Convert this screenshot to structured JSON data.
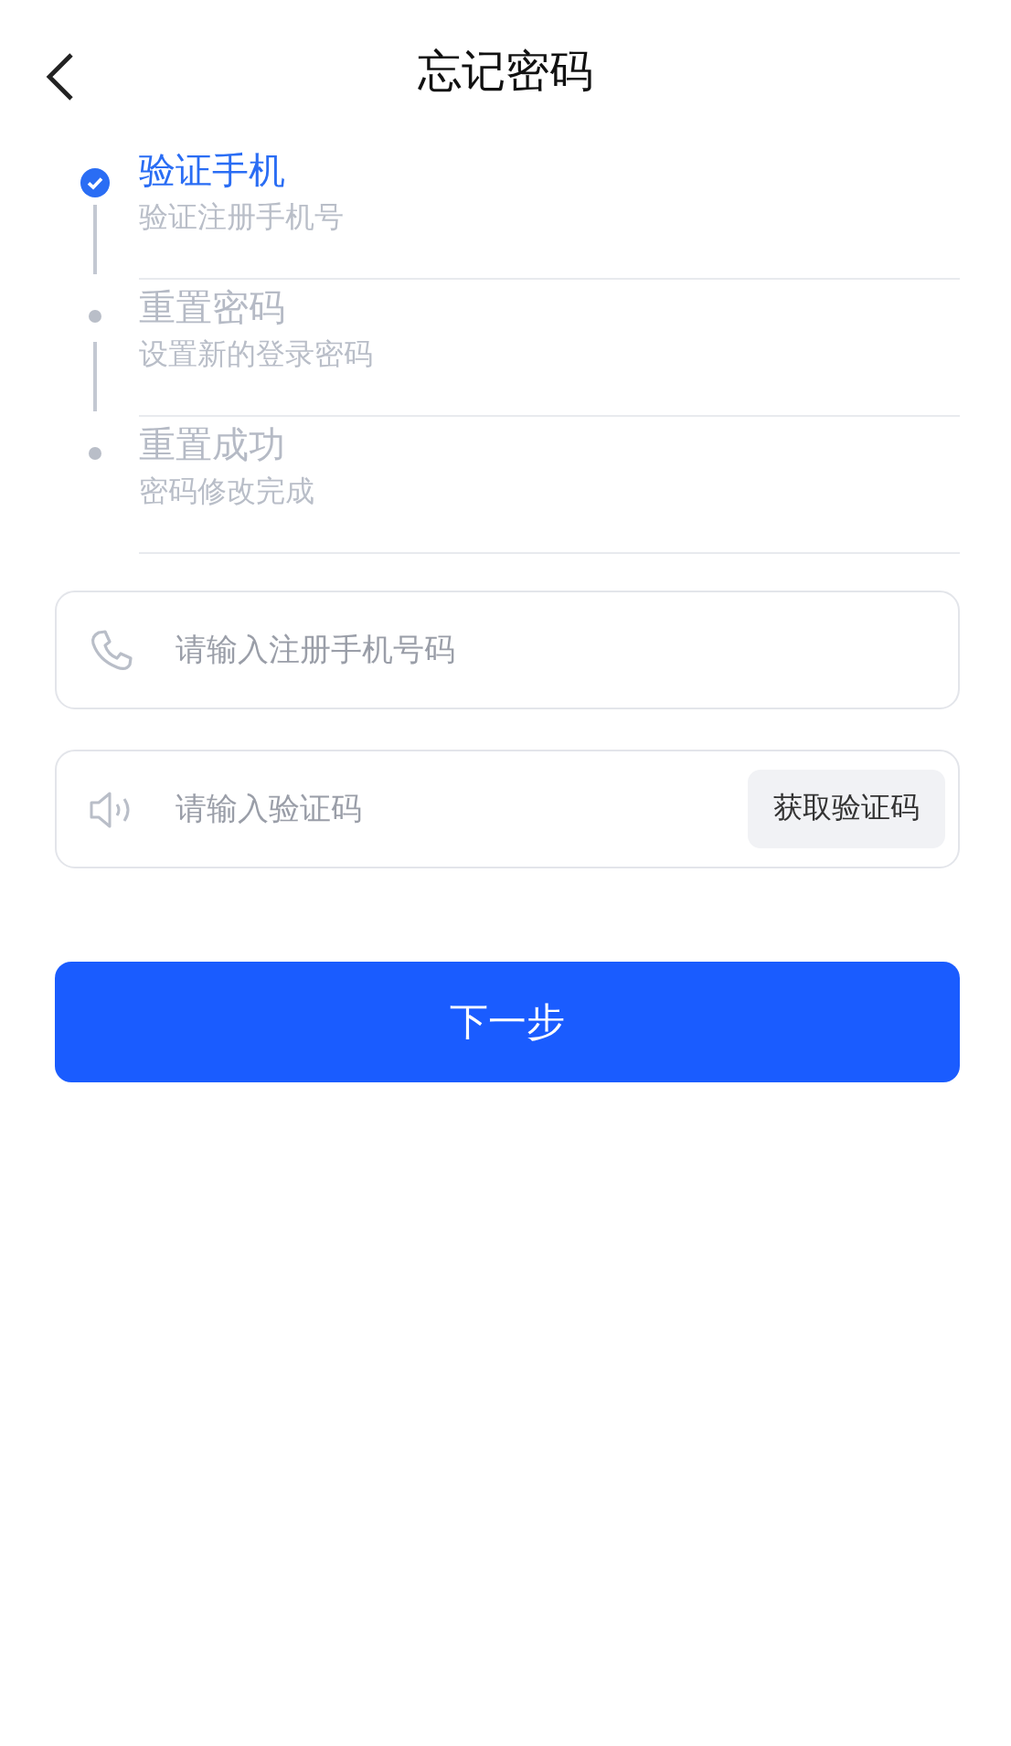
{
  "header": {
    "title": "忘记密码"
  },
  "steps": [
    {
      "title": "验证手机",
      "description": "验证注册手机号",
      "active": true
    },
    {
      "title": "重置密码",
      "description": "设置新的登录密码",
      "active": false
    },
    {
      "title": "重置成功",
      "description": "密码修改完成",
      "active": false
    }
  ],
  "fields": [
    {
      "kind": "phone",
      "placeholder": "请输入注册手机号码"
    },
    {
      "kind": "code",
      "placeholder": "请输入验证码",
      "button": "获取验证码"
    }
  ],
  "submit": "下一步"
}
